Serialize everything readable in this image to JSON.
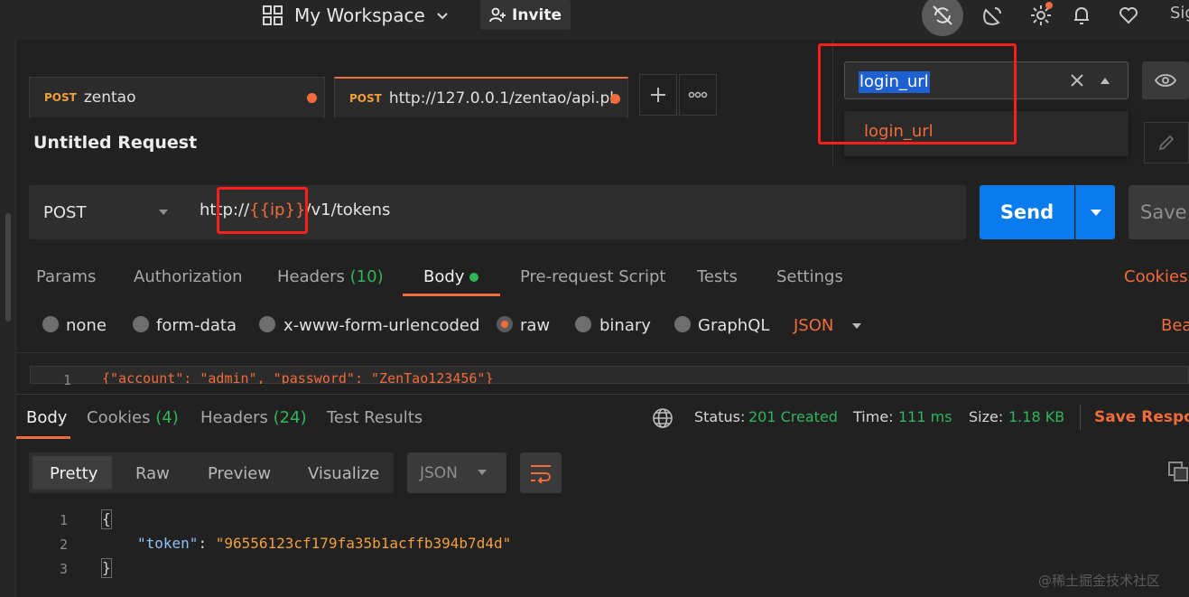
{
  "topbar": {
    "workspace": "My Workspace",
    "invite": "Invite",
    "sign_in": "Sig"
  },
  "tabs": [
    {
      "method": "POST",
      "title": "zentao"
    },
    {
      "method": "POST",
      "title": "http://127.0.0.1/zentao/api.ph..."
    }
  ],
  "environment": {
    "search_value": "login_url",
    "option": "login_url"
  },
  "request": {
    "title": "Untitled Request",
    "method": "POST",
    "url_prefix": "http://",
    "url_variable": "{{ip}}",
    "url_suffix": "/v1/tokens",
    "send": "Send",
    "save": "Save",
    "tabs": {
      "params": "Params",
      "authorization": "Authorization",
      "headers": "Headers",
      "headers_count": "(10)",
      "body": "Body",
      "prerequest": "Pre-request Script",
      "tests": "Tests",
      "settings": "Settings"
    },
    "cookies": "Cookies",
    "body_types": {
      "none": "none",
      "form_data": "form-data",
      "urlencoded": "x-www-form-urlencoded",
      "raw": "raw",
      "binary": "binary",
      "graphql": "GraphQL"
    },
    "language": "JSON",
    "beautify": "Bea",
    "editor": {
      "line": "1",
      "code": "{\"account\": \"admin\", \"password\": \"ZenTao123456\"}"
    }
  },
  "response": {
    "tabs": {
      "body": "Body",
      "cookies": "Cookies",
      "cookies_count": "(4)",
      "headers": "Headers",
      "headers_count": "(24)",
      "tests": "Test Results"
    },
    "status_label": "Status:",
    "status_value": "201 Created",
    "time_label": "Time:",
    "time_value": "111 ms",
    "size_label": "Size:",
    "size_value": "1.18 KB",
    "save": "Save Respor",
    "views": {
      "pretty": "Pretty",
      "raw": "Raw",
      "preview": "Preview",
      "visualize": "Visualize"
    },
    "format": "JSON",
    "lines": [
      "1",
      "2",
      "3"
    ],
    "open_brace": "{",
    "key": "\"token\"",
    "colon": ": ",
    "value": "\"96556123cf179fa35b1acffb394b7d4d\"",
    "close_brace": "}"
  },
  "watermark": "@稀土掘金技术社区",
  "colors": {
    "accent": "#f26b3a",
    "send": "#097bed",
    "status_ok": "#2fb55a",
    "highlight": "#ff1e1e"
  }
}
